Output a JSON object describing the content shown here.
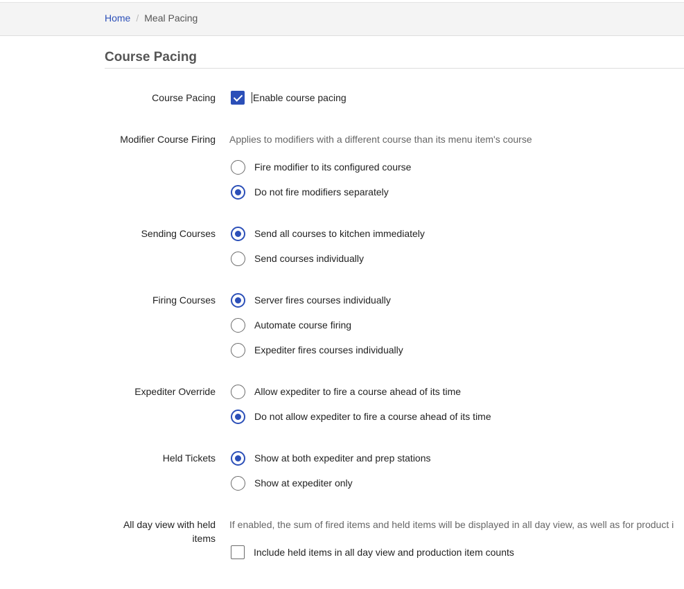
{
  "breadcrumb": {
    "home": "Home",
    "separator": "/",
    "current": "Meal Pacing"
  },
  "section": {
    "title": "Course Pacing"
  },
  "course_pacing": {
    "label": "Course Pacing",
    "option": "Enable course pacing",
    "checked": true
  },
  "modifier_course_firing": {
    "label": "Modifier Course Firing",
    "help": "Applies to modifiers with a different course than its menu item's course",
    "options": [
      {
        "label": "Fire modifier to its configured course",
        "selected": false
      },
      {
        "label": "Do not fire modifiers separately",
        "selected": true
      }
    ]
  },
  "sending_courses": {
    "label": "Sending Courses",
    "options": [
      {
        "label": "Send all courses to kitchen immediately",
        "selected": true
      },
      {
        "label": "Send courses individually",
        "selected": false
      }
    ]
  },
  "firing_courses": {
    "label": "Firing Courses",
    "options": [
      {
        "label": "Server fires courses individually",
        "selected": true
      },
      {
        "label": "Automate course firing",
        "selected": false
      },
      {
        "label": "Expediter fires courses individually",
        "selected": false
      }
    ]
  },
  "expediter_override": {
    "label": "Expediter Override",
    "options": [
      {
        "label": "Allow expediter to fire a course ahead of its time",
        "selected": false
      },
      {
        "label": "Do not allow expediter to fire a course ahead of its time",
        "selected": true
      }
    ]
  },
  "held_tickets": {
    "label": "Held Tickets",
    "options": [
      {
        "label": "Show at both expediter and prep stations",
        "selected": true
      },
      {
        "label": "Show at expediter only",
        "selected": false
      }
    ]
  },
  "all_day_view": {
    "label_line1": "All day view with held",
    "label_line2": "items",
    "help": "If enabled, the sum of fired items and held items will be displayed in all day view, as well as for product i",
    "option": "Include held items in all day view and production item counts",
    "checked": false
  },
  "colors": {
    "accent": "#2b4fb8",
    "breadcrumb_bg": "#f4f4f4",
    "help_text": "#666666"
  }
}
